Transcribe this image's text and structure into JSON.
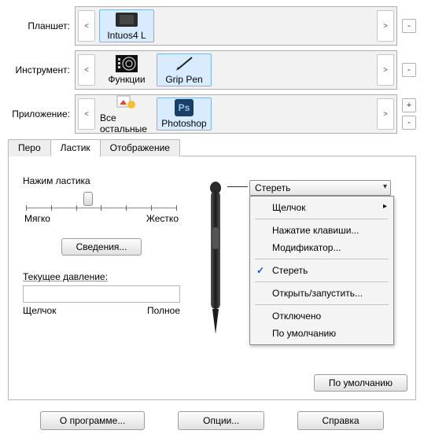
{
  "rows": {
    "tablet": {
      "label": "Планшет:",
      "items": [
        {
          "name": "Intuos4  L"
        }
      ]
    },
    "tool": {
      "label": "Инструмент:",
      "items": [
        {
          "name": "Функции"
        },
        {
          "name": "Grip Pen"
        }
      ]
    },
    "app": {
      "label": "Приложение:",
      "items": [
        {
          "name": "Все остальные"
        },
        {
          "name": "Photoshop"
        }
      ]
    }
  },
  "tabs": {
    "pen": "Перо",
    "eraser": "Ластик",
    "mapping": "Отображение"
  },
  "eraser": {
    "title": "Нажим ластика",
    "soft": "Мягко",
    "hard": "Жестко",
    "details": "Сведения...",
    "pressure_label": "Текущее давление:",
    "click": "Щелчок",
    "full": "Полное"
  },
  "combo": {
    "value": "Стереть"
  },
  "menu": {
    "click": "Щелчок",
    "keypress": "Нажатие клавиши...",
    "modifier": "Модификатор...",
    "erase": "Стереть",
    "open": "Открыть/запустить...",
    "disabled": "Отключено",
    "default": "По умолчанию"
  },
  "buttons": {
    "default": "По умолчанию",
    "about": "О программе...",
    "options": "Опции...",
    "help": "Справка"
  }
}
